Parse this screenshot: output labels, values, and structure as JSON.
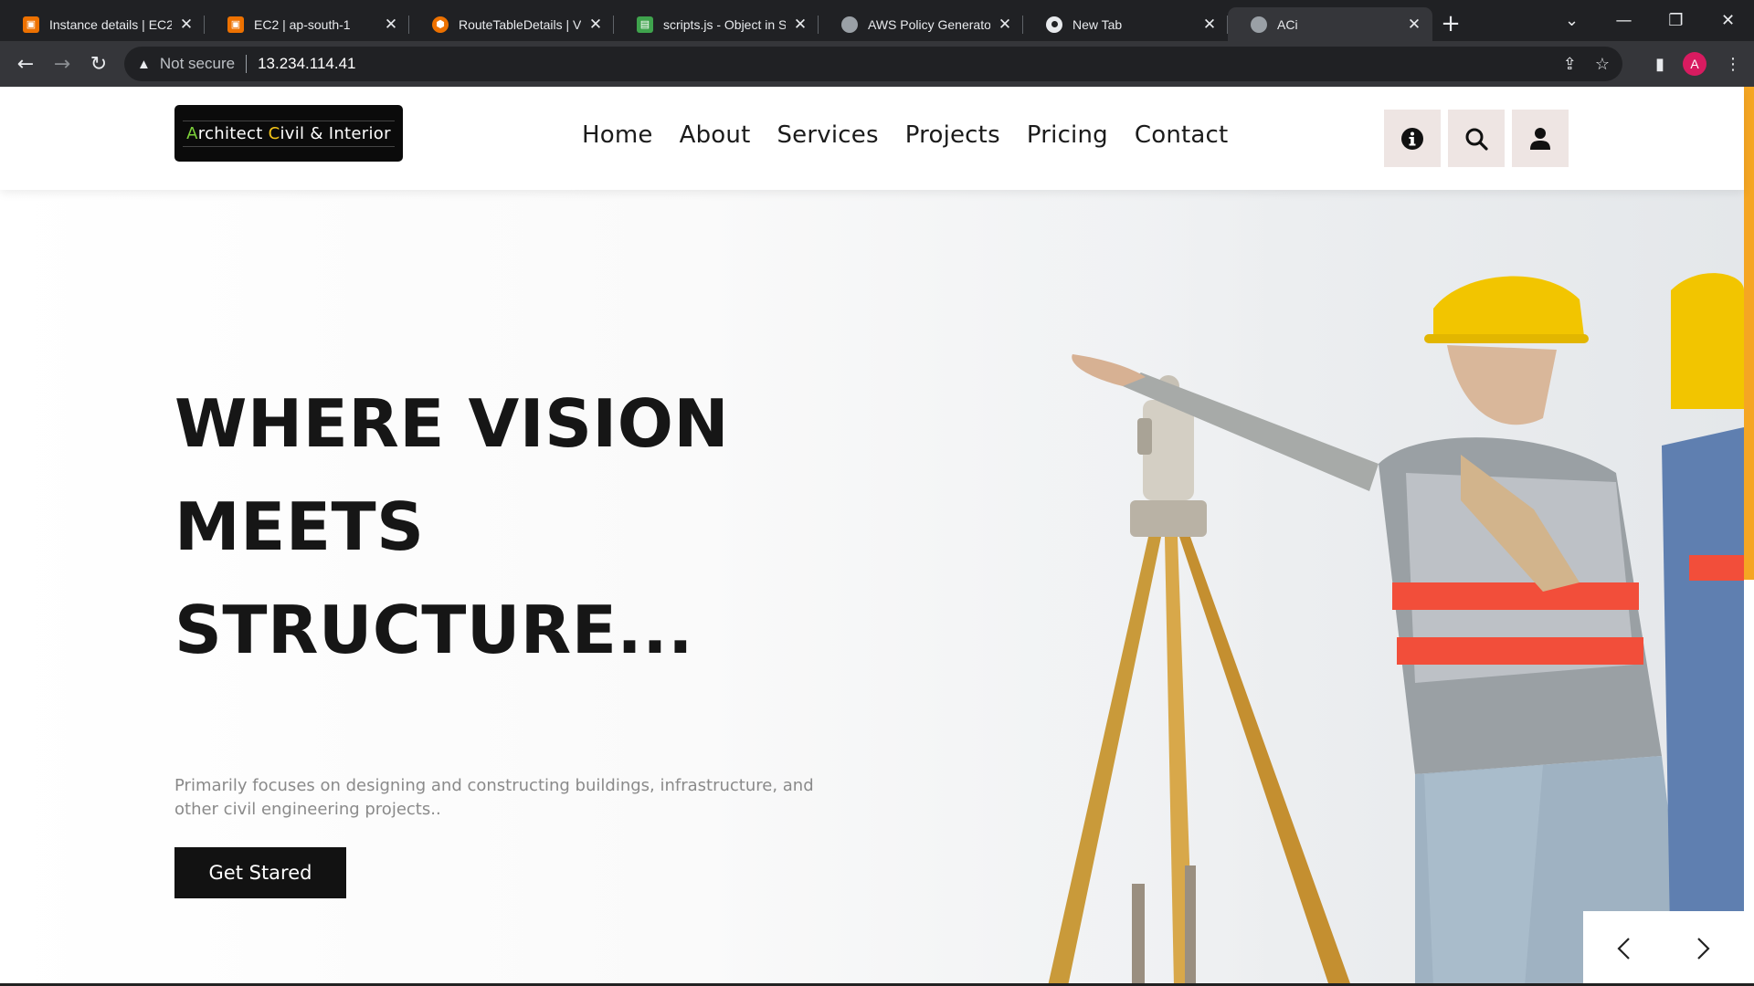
{
  "browser": {
    "tabs": [
      {
        "title": "Instance details | EC2",
        "favicon": "aws-ec2-icon"
      },
      {
        "title": "EC2 | ap-south-1",
        "favicon": "aws-ec2-icon"
      },
      {
        "title": "RouteTableDetails | V",
        "favicon": "aws-vpc-icon"
      },
      {
        "title": "scripts.js - Object in S",
        "favicon": "aws-s3-icon"
      },
      {
        "title": "AWS Policy Generato",
        "favicon": "globe-icon"
      },
      {
        "title": "New Tab",
        "favicon": "chrome-icon"
      },
      {
        "title": "ACi",
        "favicon": "globe-icon",
        "active": true
      }
    ],
    "security_label": "Not secure",
    "url": "13.234.114.41",
    "profile_initial": "A"
  },
  "site": {
    "logo": {
      "part1_first": "A",
      "part1_rest": "rchitect ",
      "part2_first": "C",
      "part2_rest": "ivil & Interior"
    },
    "menu": [
      "Home",
      "About",
      "Services",
      "Projects",
      "Pricing",
      "Contact"
    ]
  },
  "hero": {
    "title_line1": "WHERE VISION",
    "title_line2": "MEETS",
    "title_line3": "STRUCTURE...",
    "subtitle": "Primarily focuses on designing and constructing buildings, infrastructure, and other civil engineering projects..",
    "cta_label": "Get Stared"
  },
  "colors": {
    "accent_scroll": "#f5a623",
    "icon_button_bg": "#eee5e3",
    "cta_bg": "#121212"
  }
}
